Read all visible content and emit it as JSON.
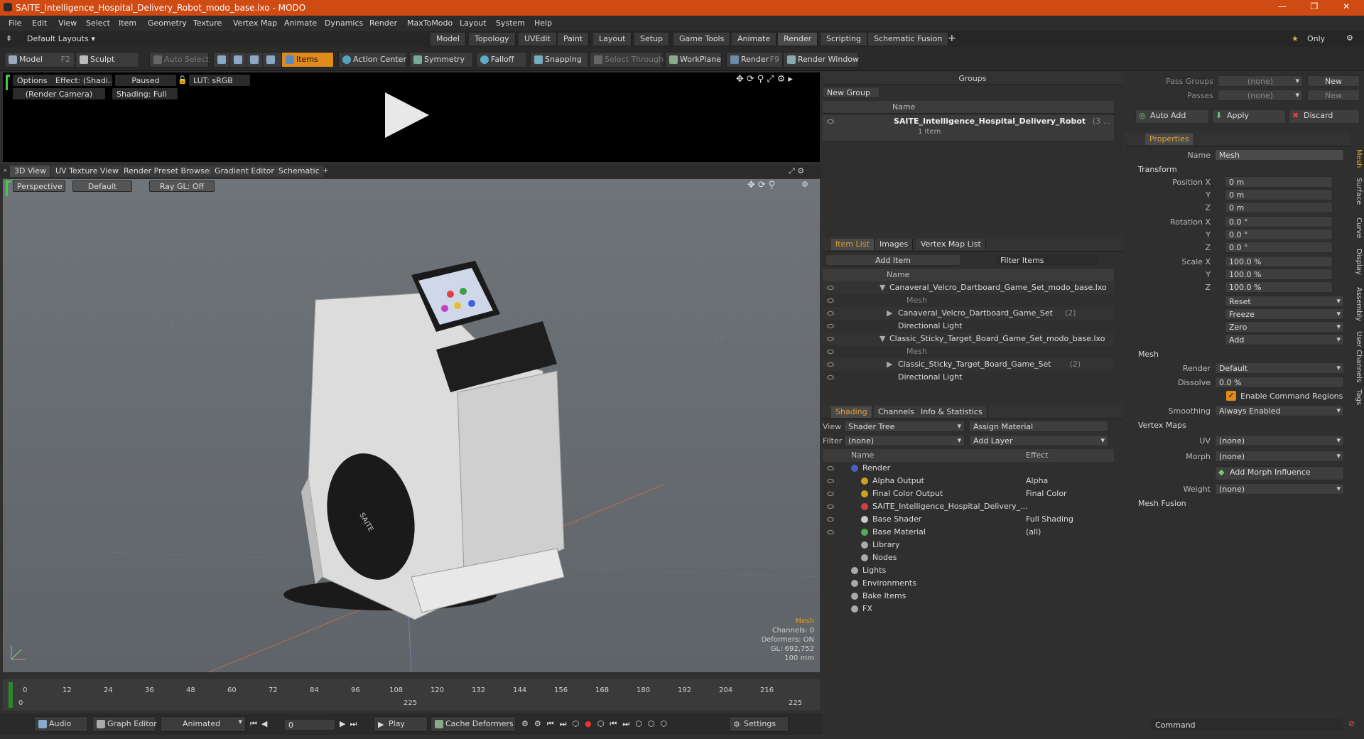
{
  "window": {
    "title": "SAITE_Intelligence_Hospital_Delivery_Robot_modo_base.lxo - MODO"
  },
  "menu": [
    "File",
    "Edit",
    "View",
    "Select",
    "Item",
    "Geometry",
    "Texture",
    "Vertex Map",
    "Animate",
    "Dynamics",
    "Render",
    "MaxToModo",
    "Layout",
    "System",
    "Help"
  ],
  "layout": {
    "default_layouts": "Default Layouts",
    "tabs": [
      "Model",
      "Topology",
      "UVEdit",
      "Paint",
      "Layout",
      "Setup",
      "Game Tools",
      "Animate",
      "Render",
      "Scripting",
      "Schematic Fusion"
    ],
    "active_tab": "Render",
    "only_label": "Only"
  },
  "toolbar": {
    "model": "Model",
    "model_key": "F2",
    "sculpt": "Sculpt",
    "auto_select": "Auto Select",
    "items": "Items",
    "action_center": "Action Center",
    "symmetry": "Symmetry",
    "falloff": "Falloff",
    "snapping": "Snapping",
    "select_through": "Select Through",
    "workplane": "WorkPlane",
    "render": "Render",
    "render_key": "F9",
    "render_window": "Render Window"
  },
  "preview": {
    "options": "Options",
    "effect": "Effect: (Shadi...",
    "paused": "Paused",
    "lut": "LUT: sRGB",
    "camera": "(Render Camera)",
    "shading": "Shading: Full"
  },
  "viewport_tabs": [
    "3D View",
    "UV Texture View",
    "Render Preset Browser",
    "Gradient Editor",
    "Schematic"
  ],
  "viewport": {
    "perspective": "Perspective",
    "style": "Default",
    "raygl": "Ray GL: Off",
    "axis_z": "-Z",
    "axis_x": "+X",
    "info": {
      "type": "Mesh",
      "channels": "Channels: 0",
      "deformers": "Deformers: ON",
      "gl": "GL: 692,752",
      "scale": "100 mm"
    },
    "robot_brand": "SAITE"
  },
  "timeline": {
    "ticks": [
      "0",
      "12",
      "24",
      "36",
      "48",
      "60",
      "72",
      "84",
      "96",
      "108",
      "120",
      "132",
      "144",
      "156",
      "168",
      "180",
      "192",
      "204",
      "216"
    ],
    "start": "0",
    "mid": "225",
    "end": "225"
  },
  "transport": {
    "audio": "Audio",
    "graph_editor": "Graph Editor",
    "animated": "Animated",
    "frame": "0",
    "play": "Play",
    "cache_deformers": "Cache Deformers",
    "settings": "Settings"
  },
  "groups": {
    "title": "Groups",
    "new_group": "New Group",
    "name_col": "Name",
    "item_name": "SAITE_Intelligence_Hospital_Delivery_Robot",
    "item_suffix": "(3 ...",
    "item_count": "1 Item"
  },
  "itemlist": {
    "tabs": [
      "Item List",
      "Images",
      "Vertex Map List"
    ],
    "add_item": "Add Item",
    "filter_items": "Filter Items",
    "name_col": "Name",
    "rows": [
      {
        "label": "Canaveral_Velcro_Dartboard_Game_Set_modo_base.lxo",
        "indent": 0,
        "suffix": ""
      },
      {
        "label": "Mesh",
        "indent": 2,
        "suffix": "",
        "dim": true
      },
      {
        "label": "Canaveral_Velcro_Dartboard_Game_Set",
        "indent": 1,
        "suffix": "(2)"
      },
      {
        "label": "Directional Light",
        "indent": 1,
        "suffix": ""
      },
      {
        "label": "Classic_Sticky_Target_Board_Game_Set_modo_base.lxo",
        "indent": 0,
        "suffix": ""
      },
      {
        "label": "Mesh",
        "indent": 2,
        "suffix": "",
        "dim": true
      },
      {
        "label": "Classic_Sticky_Target_Board_Game_Set",
        "indent": 1,
        "suffix": "(2)"
      },
      {
        "label": "Directional Light",
        "indent": 1,
        "suffix": ""
      }
    ]
  },
  "shading": {
    "tabs": [
      "Shading",
      "Channels",
      "Info & Statistics"
    ],
    "view_label": "View",
    "view_value": "Shader Tree",
    "assign_material": "Assign Material",
    "filter_label": "Filter",
    "filter_value": "(none)",
    "add_layer": "Add Layer",
    "name_col": "Name",
    "effect_col": "Effect",
    "rows": [
      {
        "name": "Render",
        "effect": ""
      },
      {
        "name": "Alpha Output",
        "effect": "Alpha"
      },
      {
        "name": "Final Color Output",
        "effect": "Final Color"
      },
      {
        "name": "SAITE_Intelligence_Hospital_Delivery_...",
        "effect": ""
      },
      {
        "name": "Base Shader",
        "effect": "Full Shading"
      },
      {
        "name": "Base Material",
        "effect": "(all)"
      },
      {
        "name": "Library",
        "effect": ""
      },
      {
        "name": "Nodes",
        "effect": ""
      },
      {
        "name": "Lights",
        "effect": ""
      },
      {
        "name": "Environments",
        "effect": ""
      },
      {
        "name": "Bake Items",
        "effect": ""
      },
      {
        "name": "FX",
        "effect": ""
      }
    ]
  },
  "passes": {
    "pass_groups": "Pass Groups",
    "passes": "Passes",
    "none": "(none)",
    "new": "New",
    "auto_add": "Auto Add",
    "apply": "Apply",
    "discard": "Discard"
  },
  "properties": {
    "tab": "Properties",
    "name_label": "Name",
    "name_value": "Mesh",
    "transform": "Transform",
    "position_label": "Position X",
    "position": [
      "0 m",
      "0 m",
      "0 m"
    ],
    "rotation_label": "Rotation X",
    "rotation": [
      "0.0 °",
      "0.0 °",
      "0.0 °"
    ],
    "scale_label": "Scale X",
    "scale": [
      "100.0 %",
      "100.0 %",
      "100.0 %"
    ],
    "y": "Y",
    "z": "Z",
    "reset": "Reset",
    "freeze": "Freeze",
    "zero": "Zero",
    "add": "Add",
    "mesh_section": "Mesh",
    "render_label": "Render",
    "render_value": "Default",
    "dissolve_label": "Dissolve",
    "dissolve_value": "0.0 %",
    "enable_cmd": "Enable Command Regions",
    "smoothing_label": "Smoothing",
    "smoothing_value": "Always Enabled",
    "vertex_maps": "Vertex Maps",
    "uv_label": "UV",
    "uv_value": "(none)",
    "morph_label": "Morph",
    "morph_value": "(none)",
    "add_morph": "Add Morph Influence",
    "weight_label": "Weight",
    "weight_value": "(none)",
    "mesh_fusion": "Mesh Fusion",
    "side_tabs": [
      "Mesh",
      "Surface",
      "Curve",
      "Display",
      "Assembly",
      "User Channels",
      "Tags"
    ]
  },
  "command": {
    "placeholder": "Command"
  },
  "colors": {
    "accent": "#d04a13",
    "items_orange": "#e08a1c"
  }
}
